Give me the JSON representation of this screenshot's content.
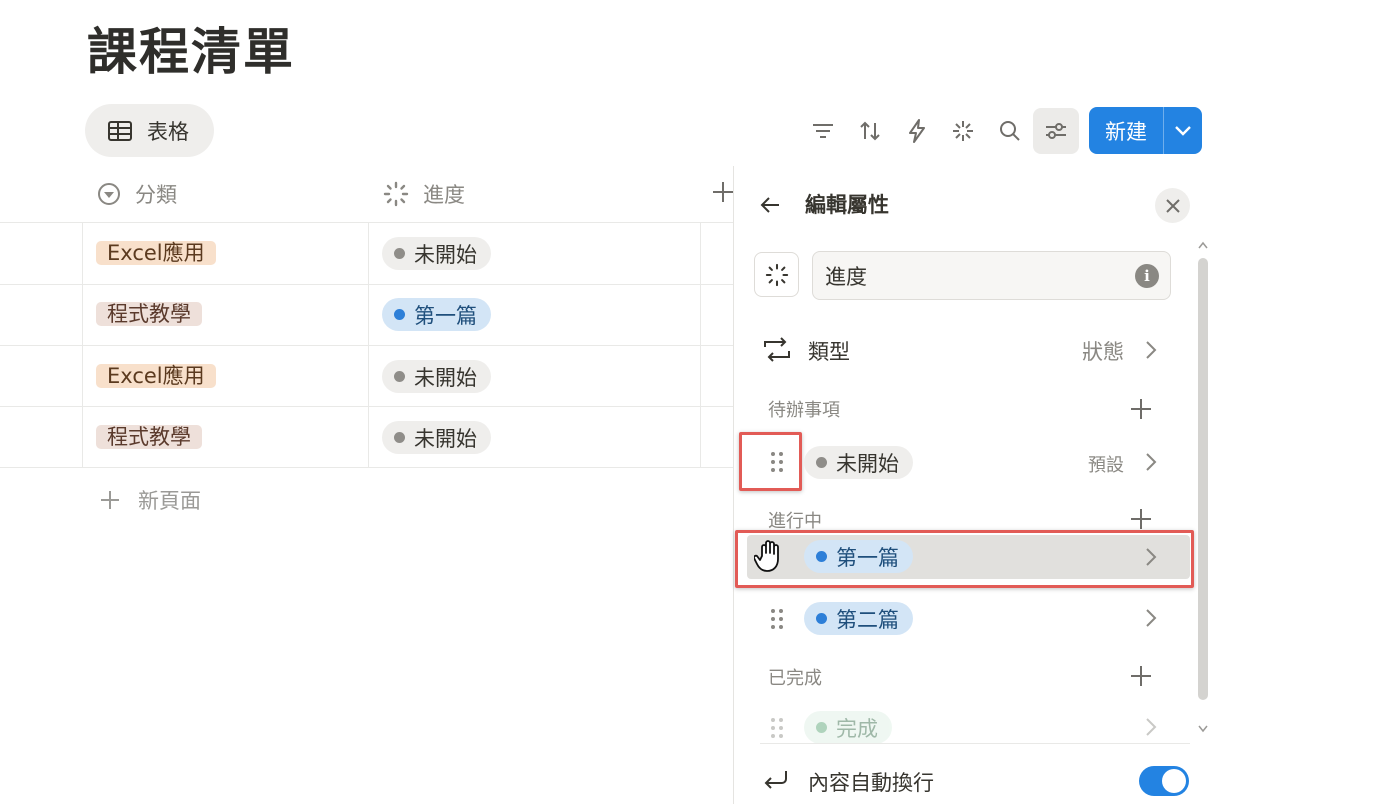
{
  "page": {
    "title": "課程清單"
  },
  "view_tab": {
    "label": "表格",
    "icon": "table-icon"
  },
  "toolbar": {
    "icons": [
      "filter-icon",
      "sort-icon",
      "automation-icon",
      "ai-icon",
      "search-icon",
      "settings-icon"
    ],
    "new_button": "新建"
  },
  "table": {
    "columns": [
      {
        "label": "分類",
        "icon": "select-icon"
      },
      {
        "label": "進度",
        "icon": "status-icon"
      }
    ],
    "rows": [
      {
        "category": "Excel應用",
        "progress": "未開始"
      },
      {
        "category": "程式教學",
        "progress": "第一篇"
      },
      {
        "category": "Excel應用",
        "progress": "未開始"
      },
      {
        "category": "程式教學",
        "progress": "未開始"
      }
    ],
    "new_page": "新頁面"
  },
  "panel": {
    "title": "編輯屬性",
    "property_name": "進度",
    "type_label": "類型",
    "type_value": "狀態",
    "groups": [
      {
        "label": "待辦事項",
        "options": [
          {
            "label": "未開始",
            "note": "預設",
            "color": "gray"
          }
        ]
      },
      {
        "label": "進行中",
        "options": [
          {
            "label": "第一篇",
            "color": "blue"
          },
          {
            "label": "第二篇",
            "color": "blue"
          }
        ]
      },
      {
        "label": "已完成",
        "options": [
          {
            "label": "完成",
            "color": "green"
          }
        ]
      }
    ],
    "wrap_label": "內容自動換行",
    "wrap_enabled": true
  },
  "colors": {
    "accent": "#2383e2",
    "highlight": "#e25b56"
  }
}
